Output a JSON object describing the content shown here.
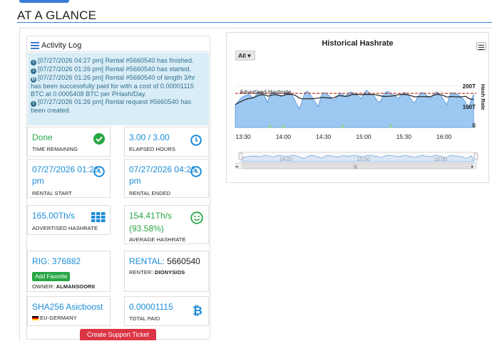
{
  "header": {
    "title": "AT A GLANCE"
  },
  "activity_log": {
    "title": "Activity Log",
    "entries": [
      {
        "icon": "info-icon",
        "text": "[07/27/2026 04:27 pm] Rental #5660540 has finished."
      },
      {
        "icon": "info-icon",
        "text": "[07/27/2026 01:26 pm] Rental #5660540 has started."
      },
      {
        "icon": "bitcoin-icon",
        "text": "[07/27/2026 01:26 pm] Rental #5660540 of length 3/hr has been successfully paid for with a cost of 0.00001115 BTC at 0.0005408 BTC per PHash/Day."
      },
      {
        "icon": "info-icon",
        "text": "[07/27/2026 01:26 pm] Rental request #5660540 has been created."
      }
    ]
  },
  "stats": {
    "time_remaining": {
      "value": "Done",
      "label": "TIME REMAINING",
      "icon": "check-circle-icon"
    },
    "elapsed_hours": {
      "value": "3.00 / 3.00",
      "label": "ELAPSED HOURS",
      "icon": "clock-icon"
    },
    "rental_start": {
      "value": "07/27/2026 01:26 pm",
      "label": "RENTAL START",
      "icon": "clock-icon"
    },
    "rental_ended": {
      "value": "07/27/2026 04:26 pm",
      "label": "RENTAL ENDED",
      "icon": "clock-icon"
    },
    "advertised_hashrate": {
      "value": "165.00Th/s",
      "label": "ADVERTISED HASHRATE",
      "icon": "grid-icon"
    },
    "average_hashrate": {
      "value": "154.41Th/s",
      "percent": "(93.58%)",
      "label": "AVERAGE HASHRATE",
      "icon": "smile-icon"
    },
    "rig": {
      "value": "RIG: 376882",
      "button": "Add Favorite",
      "owner_label": "OWNER:",
      "owner": "ALMANSOORII"
    },
    "rental": {
      "prefix": "RENTAL:",
      "id": "5660540",
      "renter_label": "RENTER:",
      "renter": "DIONYSIOS"
    },
    "algo": {
      "value": "SHA256 Asicboost",
      "region": "EU-GERMANY"
    },
    "total_paid": {
      "value": "0.00001115",
      "label": "TOTAL PAID",
      "icon": "bitcoin-icon"
    }
  },
  "support_button": "Create Support Ticket",
  "chart": {
    "range_button": "All ▾",
    "menu_icon": "hamburger-icon"
  },
  "chart_data": {
    "type": "area",
    "title": "Historical Hashrate",
    "ylabel": "Hash Rate",
    "y_ticks": [
      "0",
      "100T",
      "200T"
    ],
    "x_ticks": [
      "13:30",
      "14:00",
      "14:30",
      "15:00",
      "15:30",
      "16:00"
    ],
    "navigator_ticks": [
      "14:00",
      "15:00",
      "16:00"
    ],
    "ylim": [
      0,
      200
    ],
    "plot_line_label": "Advertised Hashrate",
    "plot_line_value": 165,
    "series": [
      {
        "name": "Hash Rate",
        "color": "#7cb5ec",
        "x_minutes_from_1330": [
          0,
          2,
          4,
          6,
          8,
          10,
          12,
          14,
          16,
          18,
          20,
          22,
          24,
          26,
          28,
          30,
          32,
          34,
          36,
          38,
          40,
          42,
          44,
          46,
          48,
          50,
          52,
          54,
          56,
          58,
          60,
          62,
          64,
          66,
          68,
          70,
          72,
          74,
          76,
          78,
          80,
          82,
          84,
          86,
          88,
          90,
          92,
          94,
          96,
          98,
          100,
          102,
          104,
          106,
          108,
          110,
          112,
          114,
          116,
          118,
          120,
          122,
          124,
          126,
          128,
          130,
          132,
          134,
          136,
          138,
          140,
          142,
          144,
          146,
          148,
          150,
          152,
          154,
          156,
          158,
          160,
          162,
          164,
          166,
          168,
          170,
          172,
          174,
          176,
          178
        ],
        "values": [
          110,
          125,
          140,
          150,
          155,
          160,
          150,
          140,
          165,
          172,
          168,
          150,
          120,
          160,
          170,
          165,
          160,
          150,
          155,
          168,
          170,
          160,
          140,
          110,
          90,
          130,
          170,
          175,
          160,
          140,
          120,
          100,
          150,
          170,
          165,
          155,
          140,
          130,
          150,
          168,
          160,
          150,
          165,
          172,
          168,
          160,
          150,
          140,
          165,
          180,
          170,
          160,
          150,
          130,
          120,
          150,
          170,
          175,
          165,
          160,
          150,
          140,
          160,
          170,
          165,
          150,
          130,
          120,
          145,
          165,
          170,
          160,
          150,
          140,
          160,
          172,
          168,
          150,
          130,
          110,
          150,
          170,
          165,
          160,
          150,
          140,
          120,
          90,
          130,
          160
        ]
      }
    ],
    "grid": true
  }
}
